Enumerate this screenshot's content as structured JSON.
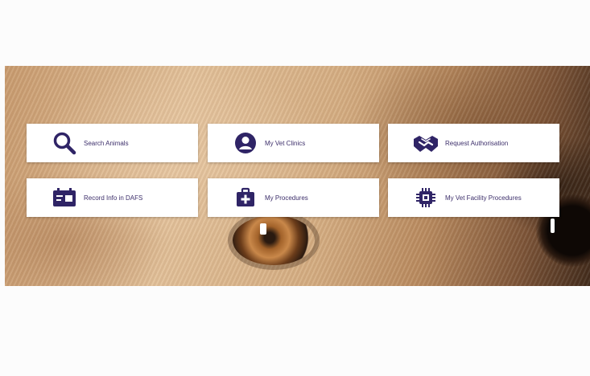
{
  "colors": {
    "accent": "#2f2466",
    "label": "#3d2f6b",
    "tile_background": "#ffffff"
  },
  "tiles": [
    {
      "label": "Search Animals",
      "icon": "search-icon"
    },
    {
      "label": "My Vet Clinics",
      "icon": "user-circle-icon"
    },
    {
      "label": "Request Authorisation",
      "icon": "handshake-icon"
    },
    {
      "label": "Record Info in DAFS",
      "icon": "calendar-card-icon"
    },
    {
      "label": "My Procedures",
      "icon": "medical-kit-icon"
    },
    {
      "label": "My Vet Facility Procedures",
      "icon": "chip-icon"
    }
  ]
}
